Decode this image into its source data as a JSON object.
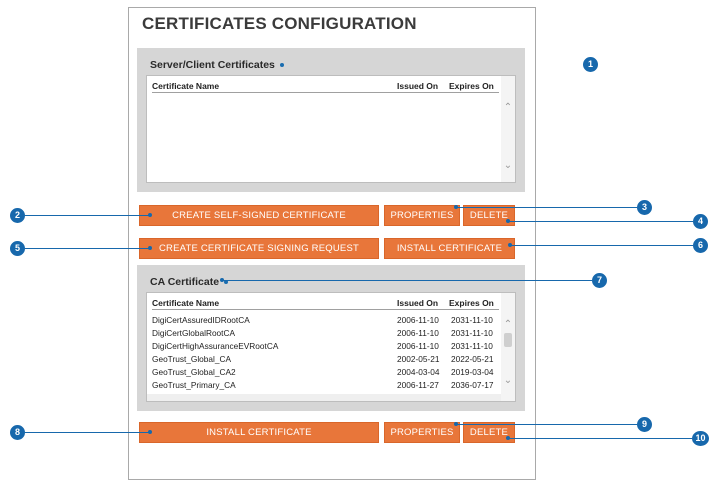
{
  "page": {
    "title": "CERTIFICATES CONFIGURATION"
  },
  "server_client": {
    "title": "Server/Client Certificates",
    "columns": {
      "name": "Certificate Name",
      "issued": "Issued On",
      "expires": "Expires On"
    },
    "rows": []
  },
  "buttons_server": {
    "create_self_signed": "CREATE SELF-SIGNED CERTIFICATE",
    "properties": "PROPERTIES",
    "delete": "DELETE",
    "create_csr": "CREATE CERTIFICATE SIGNING REQUEST",
    "install": "INSTALL CERTIFICATE"
  },
  "ca": {
    "title": "CA Certificate",
    "columns": {
      "name": "Certificate Name",
      "issued": "Issued On",
      "expires": "Expires On"
    },
    "rows": [
      {
        "name": "DigiCertAssuredIDRootCA",
        "issued": "2006-11-10",
        "expires": "2031-11-10"
      },
      {
        "name": "DigiCertGlobalRootCA",
        "issued": "2006-11-10",
        "expires": "2031-11-10"
      },
      {
        "name": "DigiCertHighAssuranceEVRootCA",
        "issued": "2006-11-10",
        "expires": "2031-11-10"
      },
      {
        "name": "GeoTrust_Global_CA",
        "issued": "2002-05-21",
        "expires": "2022-05-21"
      },
      {
        "name": "GeoTrust_Global_CA2",
        "issued": "2004-03-04",
        "expires": "2019-03-04"
      },
      {
        "name": "GeoTrust_Primary_CA",
        "issued": "2006-11-27",
        "expires": "2036-07-17"
      }
    ]
  },
  "buttons_ca": {
    "install": "INSTALL CERTIFICATE",
    "properties": "PROPERTIES",
    "delete": "DELETE"
  },
  "callouts": [
    "1",
    "2",
    "3",
    "4",
    "5",
    "6",
    "7",
    "8",
    "9",
    "10"
  ],
  "colors": {
    "button": "#e8763a",
    "callout": "#1768ac",
    "group_bg": "#d6d6d6"
  }
}
